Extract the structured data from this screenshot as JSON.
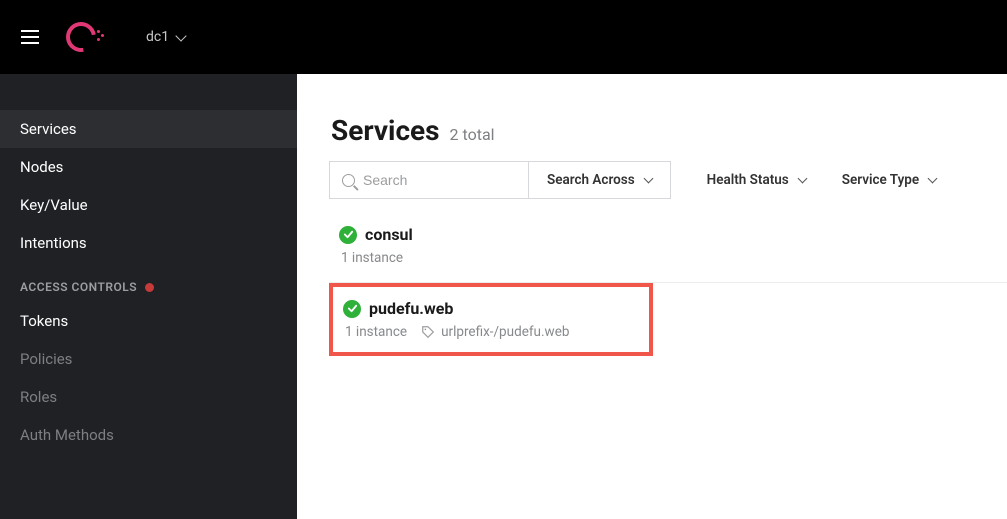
{
  "topbar": {
    "datacenter": "dc1"
  },
  "sidebar": {
    "items": [
      {
        "label": "Services",
        "active": true
      },
      {
        "label": "Nodes"
      },
      {
        "label": "Key/Value"
      },
      {
        "label": "Intentions"
      }
    ],
    "access_section": {
      "header": "ACCESS CONTROLS",
      "items": [
        {
          "label": "Tokens",
          "muted": false
        },
        {
          "label": "Policies",
          "muted": true
        },
        {
          "label": "Roles",
          "muted": true
        },
        {
          "label": "Auth Methods",
          "muted": true
        }
      ]
    }
  },
  "page": {
    "title": "Services",
    "count_label": "2 total"
  },
  "toolbar": {
    "search_placeholder": "Search",
    "search_across": "Search Across",
    "health_status": "Health Status",
    "service_type": "Service Type"
  },
  "services": [
    {
      "name": "consul",
      "instances": "1 instance",
      "tag": null,
      "highlighted": false
    },
    {
      "name": "pudefu.web",
      "instances": "1 instance",
      "tag": "urlprefix-/pudefu.web",
      "highlighted": true
    }
  ]
}
